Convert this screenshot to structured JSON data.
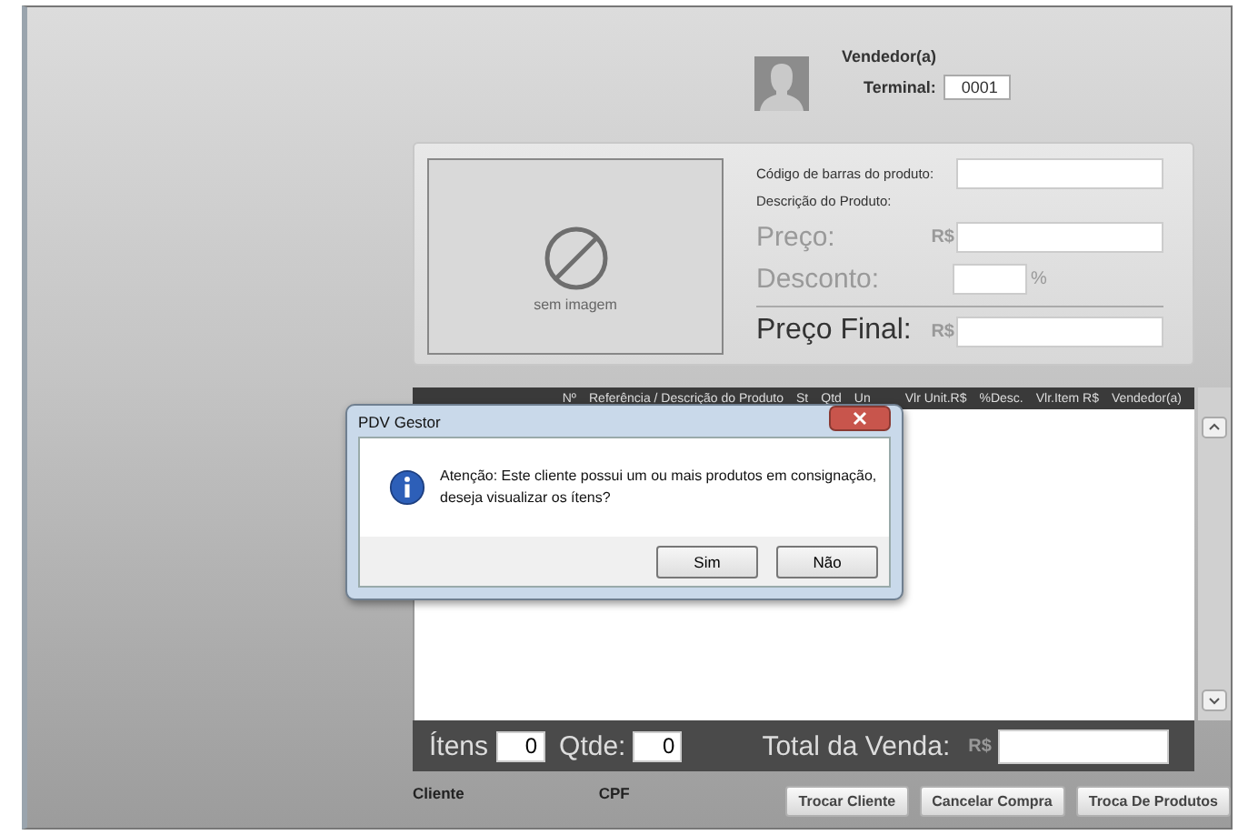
{
  "seller": {
    "label": "Vendedor(a)",
    "terminal_label": "Terminal:",
    "terminal": "0001"
  },
  "product": {
    "image_caption": "sem imagem",
    "barcode_label": "Código de barras do produto:",
    "description_label": "Descrição do Produto:",
    "price_label": "Preço:",
    "price_currency": "R$",
    "discount_label": "Desconto:",
    "discount_unit": "%",
    "final_label": "Preço Final:",
    "final_currency": "R$"
  },
  "table": {
    "columns": [
      "Nº",
      "Referência / Descrição do Produto",
      "St",
      "Qtd",
      "Un",
      "Vlr Unit.R$",
      "%Desc.",
      "Vlr.Item R$",
      "Vendedor(a)"
    ]
  },
  "totals": {
    "items_label": "Ítens",
    "items": "0",
    "qty_label": "Qtde:",
    "qty": "0",
    "total_label": "Total da Venda:",
    "total_currency": "R$"
  },
  "customer": {
    "name_label": "Cliente",
    "cpf_label": "CPF"
  },
  "buttons": [
    "Trocar Cliente",
    "Cancelar Compra",
    "Troca De Produtos"
  ],
  "dialog": {
    "title": "PDV Gestor",
    "message": "Atenção: Este cliente possui um ou mais produtos em consignação,\ndeseja visualizar os ítens?",
    "buttons": [
      "Sim",
      "Não"
    ]
  }
}
